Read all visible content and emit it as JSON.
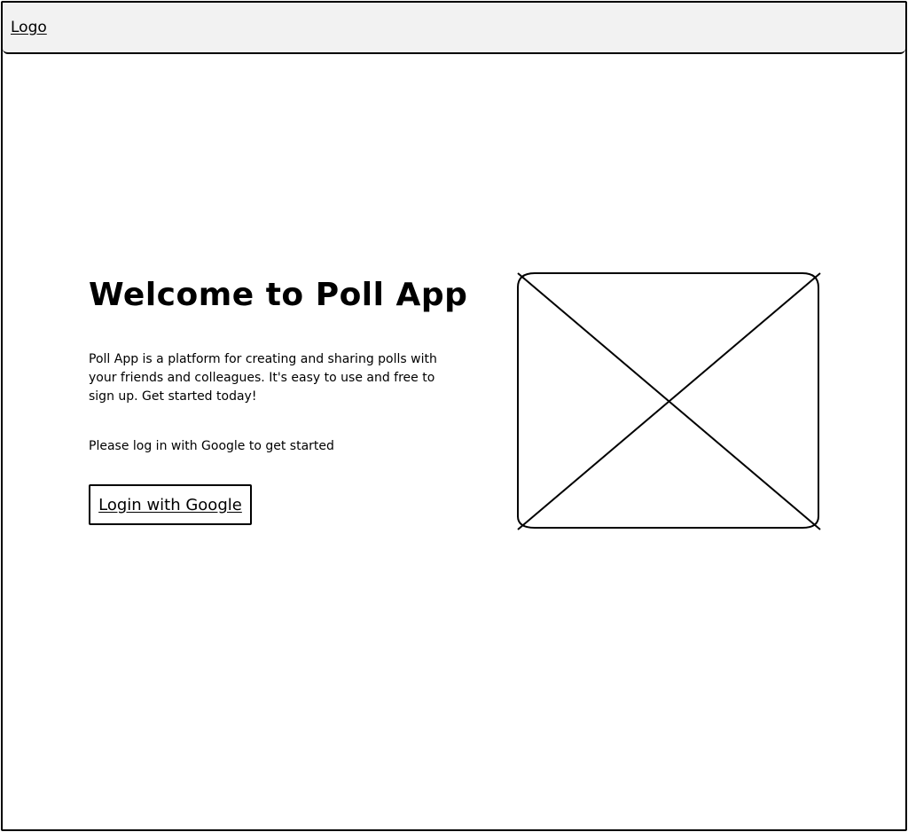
{
  "header": {
    "logo_label": "Logo"
  },
  "hero": {
    "title": "Welcome to Poll App",
    "description": "Poll App is a platform for creating and sharing polls with your friends and colleagues. It's easy to use and free to sign up. Get started today!",
    "prompt": "Please log in with Google to get  started",
    "login_button_label": "Login with Google"
  },
  "image": {
    "icon": "image-placeholder-icon"
  }
}
